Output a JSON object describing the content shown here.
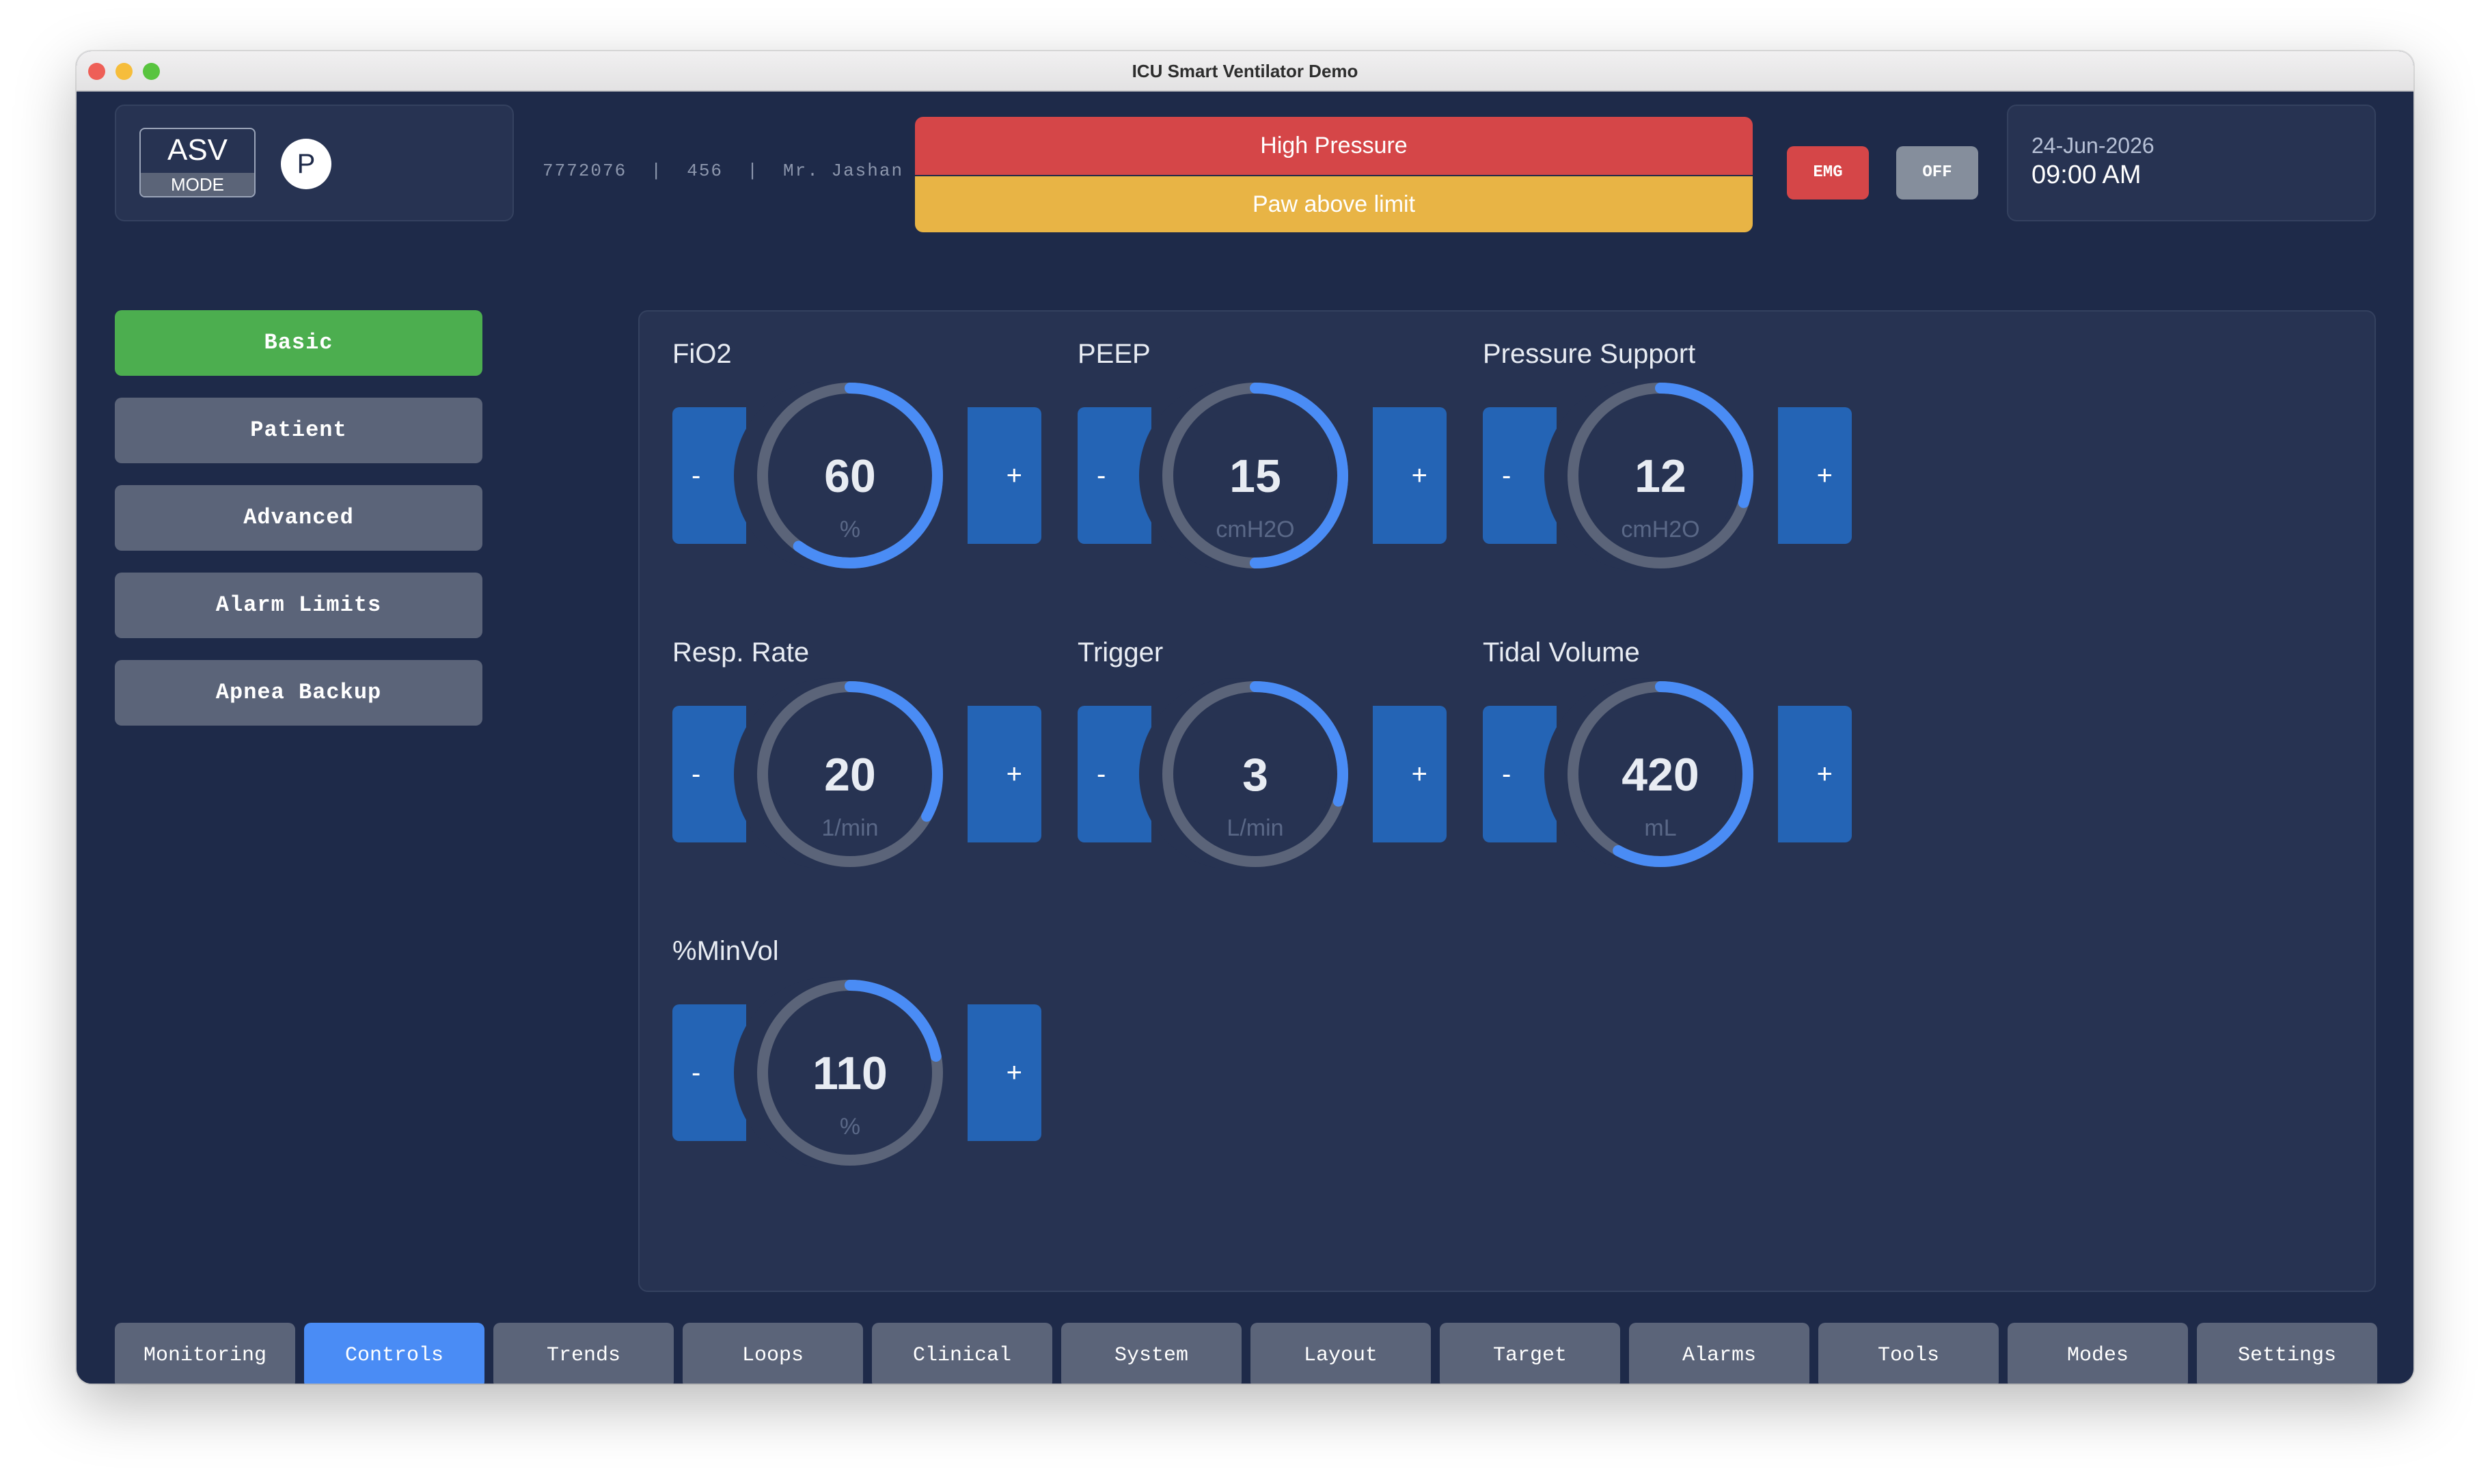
{
  "window": {
    "title": "ICU Smart Ventilator Demo"
  },
  "header": {
    "mode_name": "ASV",
    "mode_label": "MODE",
    "p_label": "P",
    "patient_info": "7772076  |  456  |  Mr. Jashan",
    "alarm_primary": "High Pressure",
    "alarm_secondary": "Paw above limit",
    "emg_label": "EMG",
    "off_label": "OFF",
    "date": "24-Jun-2026",
    "time": "09:00 AM"
  },
  "sidebar": {
    "items": [
      {
        "label": "Basic",
        "active": true
      },
      {
        "label": "Patient"
      },
      {
        "label": "Advanced"
      },
      {
        "label": "Alarm Limits"
      },
      {
        "label": "Apnea Backup"
      }
    ]
  },
  "controls": [
    {
      "label": "FiO2",
      "value": "60",
      "unit": "%",
      "fill": 0.6
    },
    {
      "label": "PEEP",
      "value": "15",
      "unit": "cmH2O",
      "fill": 0.5
    },
    {
      "label": "Pressure Support",
      "value": "12",
      "unit": "cmH2O",
      "fill": 0.3
    },
    {
      "label": "Resp. Rate",
      "value": "20",
      "unit": "1/min",
      "fill": 0.33
    },
    {
      "label": "Trigger",
      "value": "3",
      "unit": "L/min",
      "fill": 0.3
    },
    {
      "label": "Tidal Volume",
      "value": "420",
      "unit": "mL",
      "fill": 0.58
    },
    {
      "label": "%MinVol",
      "value": "110",
      "unit": "%",
      "fill": 0.22
    }
  ],
  "stepper": {
    "minus": "-",
    "plus": "+"
  },
  "nav": {
    "items": [
      {
        "label": "Monitoring"
      },
      {
        "label": "Controls",
        "active": true
      },
      {
        "label": "Trends"
      },
      {
        "label": "Loops"
      },
      {
        "label": "Clinical"
      },
      {
        "label": "System"
      },
      {
        "label": "Layout"
      },
      {
        "label": "Target"
      },
      {
        "label": "Alarms"
      },
      {
        "label": "Tools"
      },
      {
        "label": "Modes"
      },
      {
        "label": "Settings"
      }
    ]
  },
  "colors": {
    "background": "#1e2a49",
    "panel": "#273352",
    "active_green": "#4cae4f",
    "active_blue": "#4a8cf5",
    "alarm_red": "#d54648",
    "alarm_yellow": "#e8b445",
    "gauge_track": "#5b6479",
    "gauge_fill": "#4a8cf5",
    "stepper_blue": "#2464b5"
  }
}
